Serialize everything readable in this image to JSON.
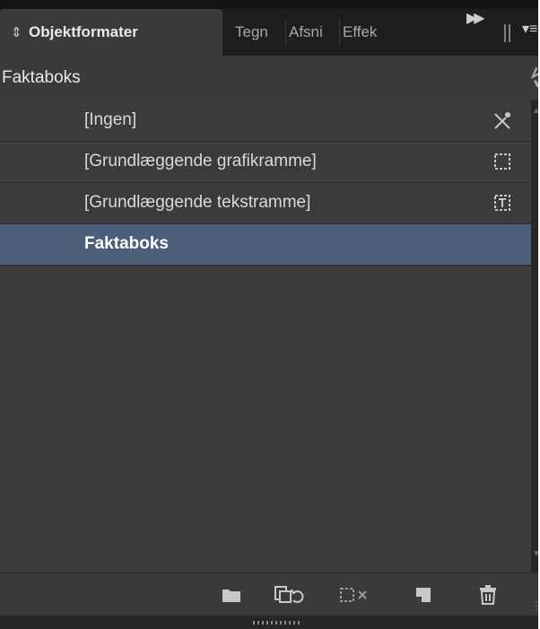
{
  "tabs": [
    {
      "label": "Objektformater",
      "active": true
    },
    {
      "label": "Tegn",
      "active": false
    },
    {
      "label": "Afsni",
      "active": false
    },
    {
      "label": "Effek",
      "active": false
    }
  ],
  "current_style": "Faktaboks",
  "styles": [
    {
      "label": "[Ingen]",
      "icon": "no-style-icon",
      "selected": false
    },
    {
      "label": "[Grundlæggende grafikramme]",
      "icon": "graphic-frame-icon",
      "selected": false
    },
    {
      "label": "[Grundlæggende tekstramme]",
      "icon": "text-frame-icon",
      "selected": false
    },
    {
      "label": "Faktaboks",
      "icon": "",
      "selected": true
    }
  ],
  "footer_buttons": [
    "new-group-icon",
    "load-styles-icon",
    "clear-overrides-icon",
    "new-style-icon",
    "delete-style-icon"
  ],
  "colors": {
    "panel_bg": "#3b3b3b",
    "selected_row": "#4c5f7a",
    "tab_bar": "#1e1e1e"
  }
}
